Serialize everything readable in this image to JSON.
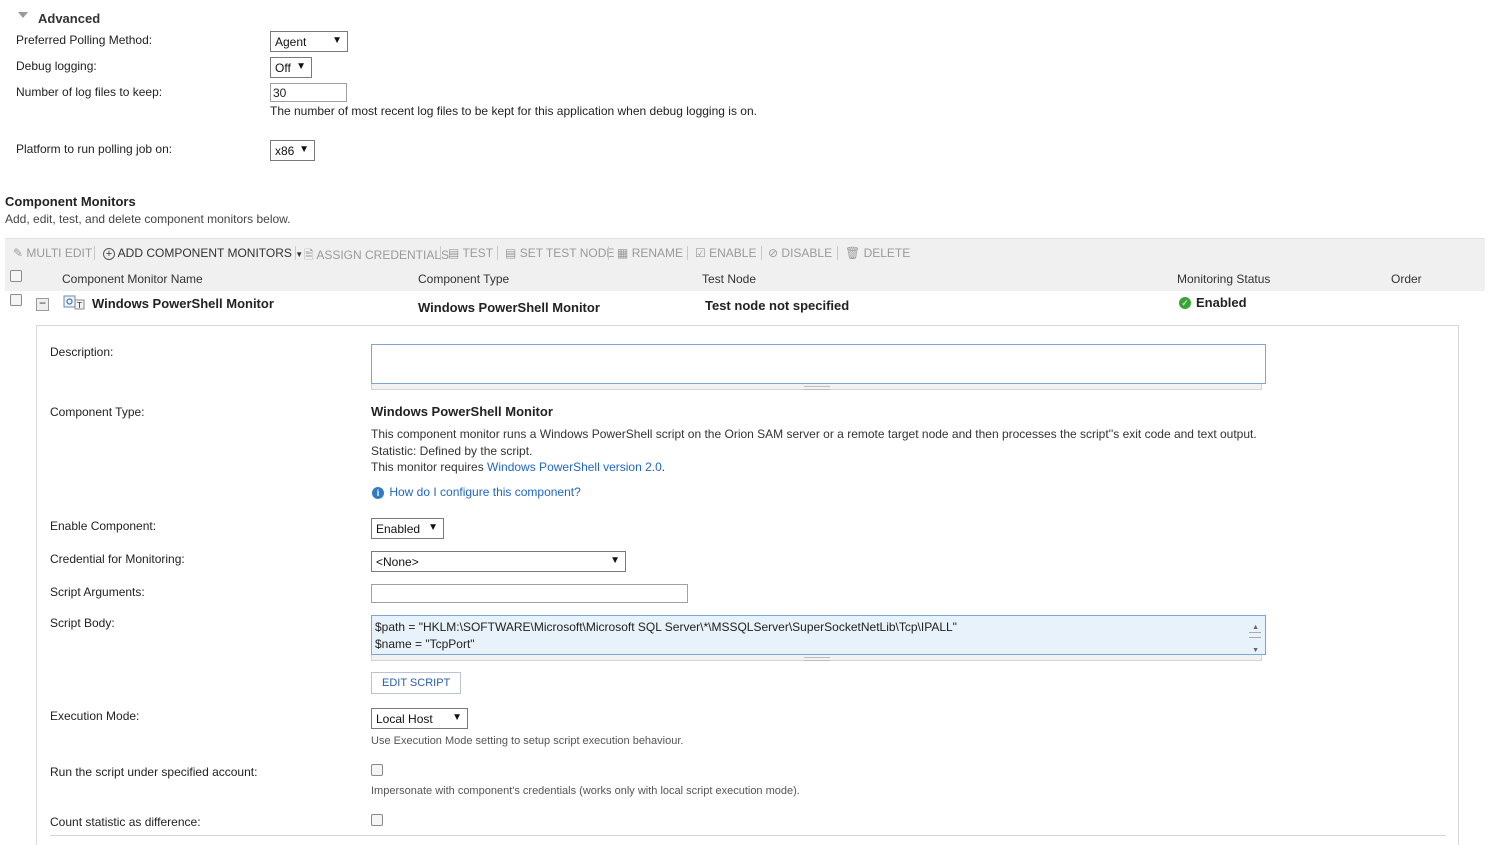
{
  "advanced": {
    "title": "Advanced",
    "polling_label": "Preferred Polling Method:",
    "polling_value": "Agent",
    "debug_label": "Debug logging:",
    "debug_value": "Off",
    "logfiles_label": "Number of log files to keep:",
    "logfiles_value": "30",
    "logfiles_hint": "The number of most recent log files to be kept for this application when debug logging is on.",
    "platform_label": "Platform to run polling job on:",
    "platform_value": "x86"
  },
  "component_monitors": {
    "title": "Component Monitors",
    "subtitle": "Add, edit, test, and delete component monitors below."
  },
  "toolbar": {
    "multi_edit": "MULTI EDIT",
    "add_component_monitors": "ADD COMPONENT MONITORS",
    "assign_credentials": "ASSIGN CREDENTIALS",
    "test": "TEST",
    "set_test_node": "SET TEST NODE",
    "rename": "RENAME",
    "enable": "ENABLE",
    "disable": "DISABLE",
    "delete": "DELETE"
  },
  "table": {
    "columns": [
      "Component Monitor Name",
      "Component Type",
      "Test Node",
      "Monitoring Status",
      "Order"
    ],
    "row": {
      "name": "Windows PowerShell Monitor",
      "type": "Windows PowerShell Monitor",
      "test_node": "Test node not specified",
      "status": "Enabled"
    }
  },
  "details": {
    "description_label": "Description:",
    "component_type_label": "Component Type:",
    "component_type_value": "Windows PowerShell Monitor",
    "component_type_desc": "This component monitor runs a Windows PowerShell script on the Orion SAM server or a remote target node and then processes the script''s exit code and text output. Statistic: Defined by the script.",
    "requires_prefix": "This monitor requires ",
    "requires_link": "Windows PowerShell version 2.0",
    "requires_suffix": ".",
    "howto_link": "How do I configure this component?",
    "enable_label": "Enable Component:",
    "enable_value": "Enabled",
    "credential_label": "Credential for Monitoring:",
    "credential_value": "<None>",
    "script_args_label": "Script Arguments:",
    "script_args_value": "",
    "script_body_label": "Script Body:",
    "script_body_line1": "$path = \"HKLM:\\SOFTWARE\\Microsoft\\Microsoft SQL Server\\*\\MSSQLServer\\SuperSocketNetLib\\Tcp\\IPALL\"",
    "script_body_line2": "$name = \"TcpPort\"",
    "edit_script": "EDIT SCRIPT",
    "exec_mode_label": "Execution Mode:",
    "exec_mode_value": "Local Host",
    "exec_mode_hint": "Use Execution Mode setting to setup script execution behaviour.",
    "run_as_label": "Run the script under specified account:",
    "run_as_hint": "Impersonate with component's credentials (works only with local script execution mode).",
    "count_diff_label": "Count statistic as difference:"
  },
  "colors": {
    "link": "#2266c4",
    "toolbar_bg": "#f0f0f0",
    "status_ok": "#3aa335",
    "script_bg": "#e8f2fa"
  }
}
